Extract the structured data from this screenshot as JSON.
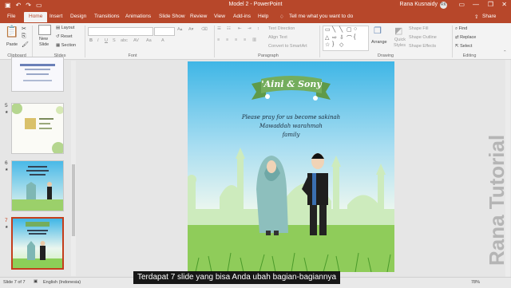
{
  "titlebar": {
    "document": "Model 2  -  PowerPoint",
    "user": "Rana Kusnaidy",
    "user_initials": "RK",
    "minimize": "—",
    "restore": "❐",
    "close": "✕"
  },
  "tabs": [
    {
      "label": "File"
    },
    {
      "label": "Home"
    },
    {
      "label": "Insert"
    },
    {
      "label": "Design"
    },
    {
      "label": "Transitions"
    },
    {
      "label": "Animations"
    },
    {
      "label": "Slide Show"
    },
    {
      "label": "Review"
    },
    {
      "label": "View"
    },
    {
      "label": "Add-ins"
    },
    {
      "label": "Help"
    }
  ],
  "tell_me": "Tell me what you want to do",
  "share": "Share",
  "ribbon": {
    "clipboard": {
      "paste": "Paste",
      "label": "Clipboard"
    },
    "slides": {
      "new_slide": "New",
      "new_slide2": "Slide",
      "layout": "Layout",
      "reset": "Reset",
      "section": "Section",
      "label": "Slides"
    },
    "font": {
      "label": "Font"
    },
    "paragraph": {
      "text_direction": "Text Direction",
      "align_text": "Align Text",
      "convert": "Convert to SmartArt",
      "label": "Paragraph"
    },
    "drawing": {
      "arrange": "Arrange",
      "quick": "Quick",
      "styles": "Styles",
      "shape_fill": "Shape Fill",
      "shape_outline": "Shape Outline",
      "shape_effects": "Shape Effects",
      "label": "Drawing"
    },
    "editing": {
      "find": "Find",
      "replace": "Replace",
      "select": "Select",
      "label": "Editing"
    }
  },
  "thumbnails": [
    {
      "num": "5"
    },
    {
      "num": "6"
    },
    {
      "num": "7"
    }
  ],
  "slide": {
    "names": "'Aini & Sony",
    "line1": "Please pray for us become sakinah",
    "line2": "Mawaddah warahmah",
    "line3": "family"
  },
  "status": {
    "slide_of": "Slide 7 of 7",
    "language": "English (Indonesia)",
    "zoom": "78%"
  },
  "caption": "Terdapat 7 slide yang bisa Anda ubah bagian-bagiannya",
  "watermark": "Rana Tutorial",
  "colors": {
    "accent": "#b7472a",
    "active_slide": "#c43e1c",
    "banner": "#74ad5d"
  }
}
